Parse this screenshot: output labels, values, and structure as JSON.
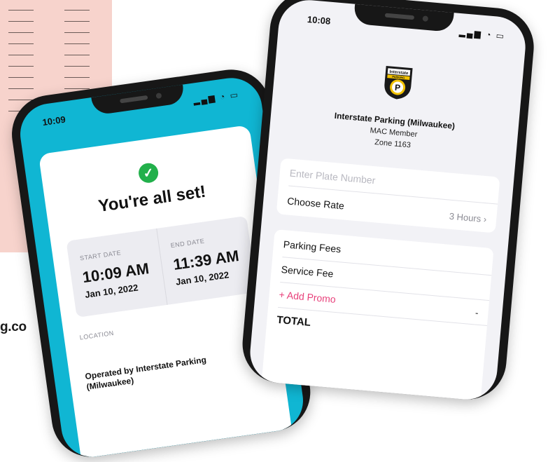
{
  "left_phone": {
    "status_time": "10:09",
    "headline": "You're all set!",
    "start": {
      "label": "START DATE",
      "time": "10:09 AM",
      "date": "Jan 10, 2022"
    },
    "end": {
      "label": "END DATE",
      "time": "11:39 AM",
      "date": "Jan 10, 2022"
    },
    "location_label": "LOCATION",
    "operated_by": "Operated by Interstate Parking (Milwaukee)"
  },
  "right_phone": {
    "status_time": "10:08",
    "business_name": "Interstate Parking (Milwaukee)",
    "membership": "MAC Member",
    "zone": "Zone 1163",
    "plate_placeholder": "Enter Plate Number",
    "choose_rate_label": "Choose Rate",
    "rate_value": "3 Hours",
    "parking_fees_label": "Parking Fees",
    "service_fee_label": "Service Fee",
    "add_promo_label": "+ Add Promo",
    "promo_value": "-",
    "total_label": "TOTAL"
  },
  "logo_text": {
    "top": "Interstate",
    "mid": "PARKING",
    "letter": "P"
  },
  "background_text": "g.co",
  "colors": {
    "teal": "#10b6d3",
    "success": "#22b04b",
    "promo": "#e8407a",
    "pink_pad": "#f7d3cc"
  }
}
